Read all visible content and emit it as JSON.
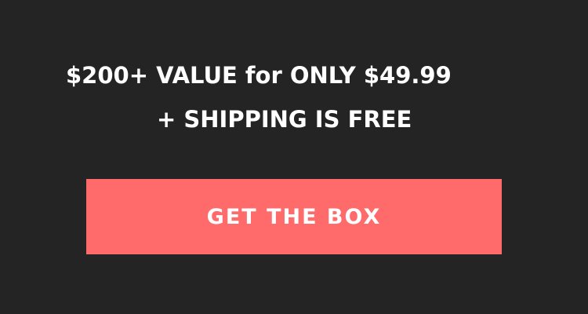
{
  "promo": {
    "headline": "$200+ VALUE for ONLY $49.99",
    "subline": "+ SHIPPING IS FREE"
  },
  "cta": {
    "label": "GET THE BOX",
    "color": "#ff6b6b"
  },
  "theme": {
    "background": "#242424",
    "text": "#ffffff"
  }
}
